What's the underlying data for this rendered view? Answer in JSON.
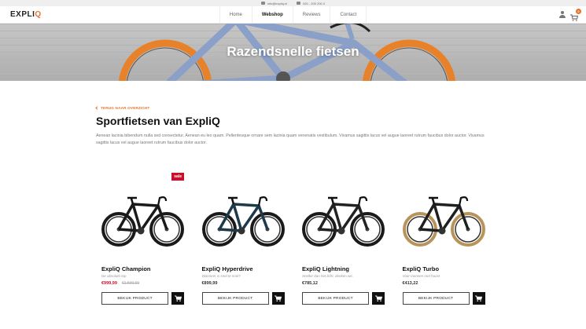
{
  "topbar": {
    "email": "info@expliq.nl",
    "phone": "020 - 200 200 0"
  },
  "logo": {
    "text_main": "EXPLI",
    "text_accent": "Q"
  },
  "nav": {
    "items": [
      {
        "label": "Home"
      },
      {
        "label": "Webshop"
      },
      {
        "label": "Reviews"
      },
      {
        "label": "Contact"
      }
    ],
    "active": "Webshop"
  },
  "cart": {
    "count": "0"
  },
  "hero": {
    "title": "Razendsnelle fietsen"
  },
  "page": {
    "back_label": "TERUG NAAR OVERZICHT",
    "title": "Sportfietsen van ExpliQ",
    "intro": "Aenean lacinia bibendum nulla sed consectetur. Aenean eu leo quam. Pellentesque ornare sem lacinia quam venenatis vestibulum. Vivamus sagittis lacus vel augue laoreet rutrum faucibus dolor auctor. Vivamus sagittis lacus vel augue laoreet rutrum faucibus dolor auctor."
  },
  "products": [
    {
      "name": "ExpliQ Champion",
      "subtitle": "De absolute top",
      "price": "€999,99",
      "old_price": "€1.500,00",
      "badge": "sale",
      "button": "BEKIJK PRODUCT",
      "frame_color": "#1a1a1a",
      "tire_color": "#1a1a1a"
    },
    {
      "name": "ExpliQ Hyperdrive",
      "subtitle": "Wanneer is snel te snel?",
      "price": "€899,99",
      "old_price": "",
      "badge": "",
      "button": "BEKIJK PRODUCT",
      "frame_color": "#1d3a4a",
      "tire_color": "#1a1a1a"
    },
    {
      "name": "ExpliQ Lightning",
      "subtitle": "Sneller dan het licht, denken we.",
      "price": "€785,12",
      "old_price": "",
      "badge": "",
      "button": "BEKIJK PRODUCT",
      "frame_color": "#222222",
      "tire_color": "#1a1a1a"
    },
    {
      "name": "ExpliQ Turbo",
      "subtitle": "Voor mensen met haast",
      "price": "€413,22",
      "old_price": "",
      "badge": "",
      "button": "BEKIJK PRODUCT",
      "frame_color": "#1f1f1f",
      "tire_color": "#b8935a"
    }
  ],
  "colors": {
    "accent": "#e8732a",
    "sale": "#c8102e"
  }
}
